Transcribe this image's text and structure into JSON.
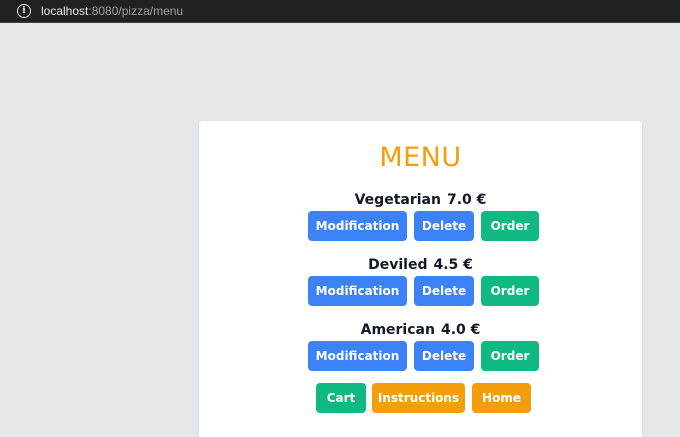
{
  "browser": {
    "url_host": "localhost",
    "url_rest": ":8080/pizza/menu"
  },
  "page": {
    "title": "MENU"
  },
  "items": [
    {
      "name": "Vegetarian",
      "price": "7.0 €",
      "modify_label": "Modification",
      "delete_label": "Delete",
      "order_label": "Order"
    },
    {
      "name": "Deviled",
      "price": "4.5 €",
      "modify_label": "Modification",
      "delete_label": "Delete",
      "order_label": "Order"
    },
    {
      "name": "American",
      "price": "4.0 €",
      "modify_label": "Modification",
      "delete_label": "Delete",
      "order_label": "Order"
    }
  ],
  "footer": {
    "cart_label": "Cart",
    "instructions_label": "Instructions",
    "home_label": "Home"
  },
  "colors": {
    "title": "#f59e0b",
    "blue": "#3b82f6",
    "green": "#10b981",
    "orange": "#f59e0b",
    "background": "#e5e7eb"
  }
}
